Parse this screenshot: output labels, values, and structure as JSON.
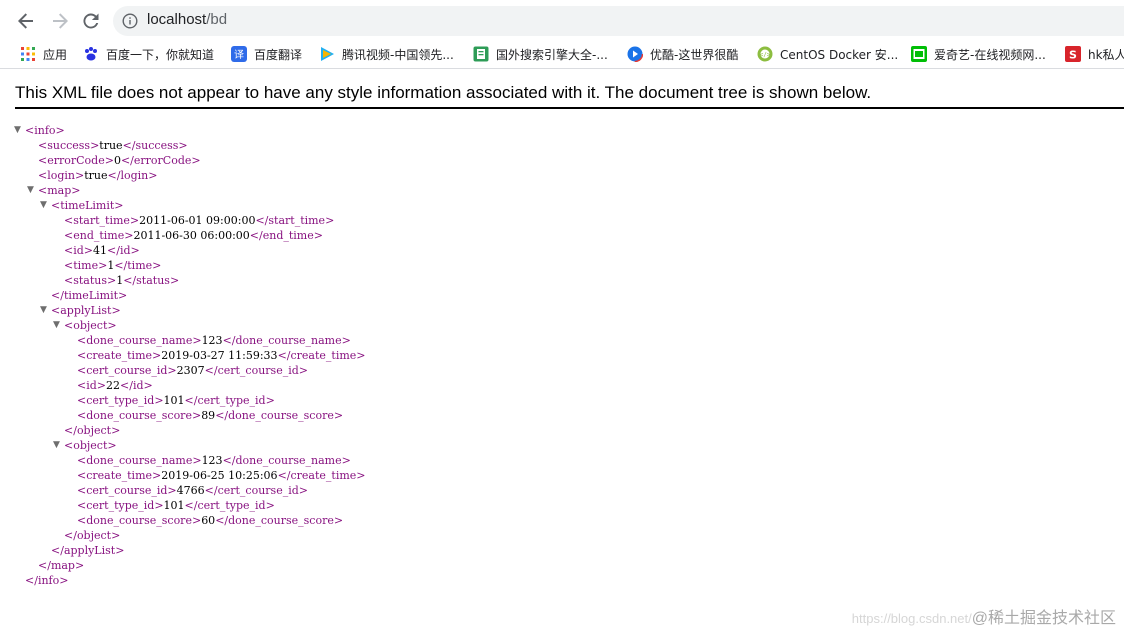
{
  "browser": {
    "url_host": "localhost",
    "url_path": "/bd",
    "bookmarks": [
      {
        "label": "应用",
        "icon": "apps-grid-icon",
        "color": "#ea4335"
      },
      {
        "label": "百度一下，你就知道",
        "icon": "baidu-paw-icon",
        "color": "#2932e1"
      },
      {
        "label": "百度翻译",
        "icon": "baidu-translate-icon",
        "color": "#2f6be9"
      },
      {
        "label": "腾讯视频-中国领先...",
        "icon": "tencent-video-icon",
        "color": "#22b0f0"
      },
      {
        "label": "国外搜索引擎大全-...",
        "icon": "search-engine-icon",
        "color": "#2e9c57"
      },
      {
        "label": "优酷-这世界很酷",
        "icon": "youku-icon",
        "color": "#1a73e8"
      },
      {
        "label": "CentOS Docker 安...",
        "icon": "docker-icon",
        "color": "#8cbd3f"
      },
      {
        "label": "爱奇艺-在线视频网...",
        "icon": "iqiyi-icon",
        "color": "#00be06"
      },
      {
        "label": "hk私人",
        "icon": "hk-icon",
        "color": "#d8242b"
      }
    ]
  },
  "banner": "This XML file does not appear to have any style information associated with it. The document tree is shown below.",
  "xml": {
    "info": "info",
    "success": "success",
    "success_v": "true",
    "errorCode": "errorCode",
    "errorCode_v": "0",
    "login": "login",
    "login_v": "true",
    "map": "map",
    "timeLimit": "timeLimit",
    "start_time": "start_time",
    "start_time_v": "2011-06-01 09:00:00",
    "end_time": "end_time",
    "end_time_v": "2011-06-30 06:00:00",
    "id": "id",
    "id_v": "41",
    "time": "time",
    "time_v": "1",
    "status": "status",
    "status_v": "1",
    "applyList": "applyList",
    "object": "object",
    "objects": [
      {
        "done_course_name": "123",
        "create_time": "2019-03-27 11:59:33",
        "cert_course_id": "2307",
        "id": "22",
        "cert_type_id": "101",
        "done_course_score": "89"
      },
      {
        "done_course_name": "123",
        "create_time": "2019-06-25 10:25:06",
        "cert_course_id": "4766",
        "cert_type_id": "101",
        "done_course_score": "60"
      }
    ],
    "f_done_course_name": "done_course_name",
    "f_create_time": "create_time",
    "f_cert_course_id": "cert_course_id",
    "f_id": "id",
    "f_cert_type_id": "cert_type_id",
    "f_done_course_score": "done_course_score"
  },
  "watermark": {
    "url": "https://blog.csdn.net/",
    "brand": "@稀土掘金技术社区"
  }
}
